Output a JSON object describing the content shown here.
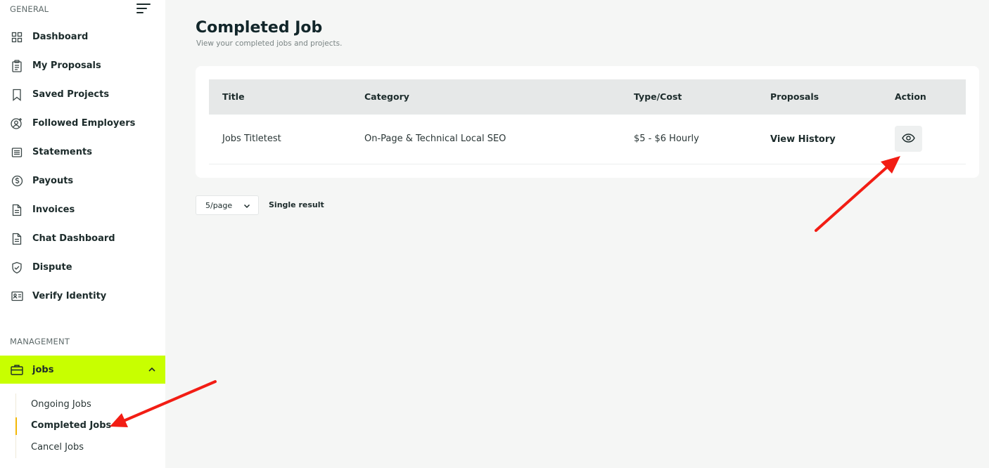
{
  "sidebar": {
    "general_label": "GENERAL",
    "management_label": "MANAGEMENT",
    "items": [
      {
        "label": "Dashboard",
        "icon": "grid-icon"
      },
      {
        "label": "My Proposals",
        "icon": "clipboard-icon"
      },
      {
        "label": "Saved Projects",
        "icon": "bookmark-icon"
      },
      {
        "label": "Followed Employers",
        "icon": "user-follow-icon"
      },
      {
        "label": "Statements",
        "icon": "list-icon"
      },
      {
        "label": "Payouts",
        "icon": "dollar-circle-icon"
      },
      {
        "label": "Invoices",
        "icon": "document-icon"
      },
      {
        "label": "Chat Dashboard",
        "icon": "document-icon"
      },
      {
        "label": "Dispute",
        "icon": "shield-check-icon"
      },
      {
        "label": "Verify Identity",
        "icon": "id-card-icon"
      }
    ],
    "jobs": {
      "label": "jobs",
      "icon": "briefcase-icon",
      "accent": "#c8ff00",
      "sub_items": [
        "Ongoing Jobs",
        "Completed Jobs",
        "Cancel Jobs"
      ],
      "active_sub": "Completed Jobs",
      "active_marker_color": "#f2b705"
    }
  },
  "main": {
    "title": "Completed Job",
    "subtitle": "View your completed jobs and projects.",
    "table": {
      "columns": [
        "Title",
        "Category",
        "Type/Cost",
        "Proposals",
        "Action"
      ],
      "rows": [
        {
          "title": "Jobs Titletest",
          "category": "On-Page & Technical Local SEO",
          "type_cost": "$5 - $6 Hourly",
          "proposals": "View History",
          "action_icon": "eye-icon"
        }
      ]
    },
    "pagination": {
      "page_size": "5/page",
      "result_text": "Single result"
    }
  },
  "annotation_color": "#f21d14"
}
